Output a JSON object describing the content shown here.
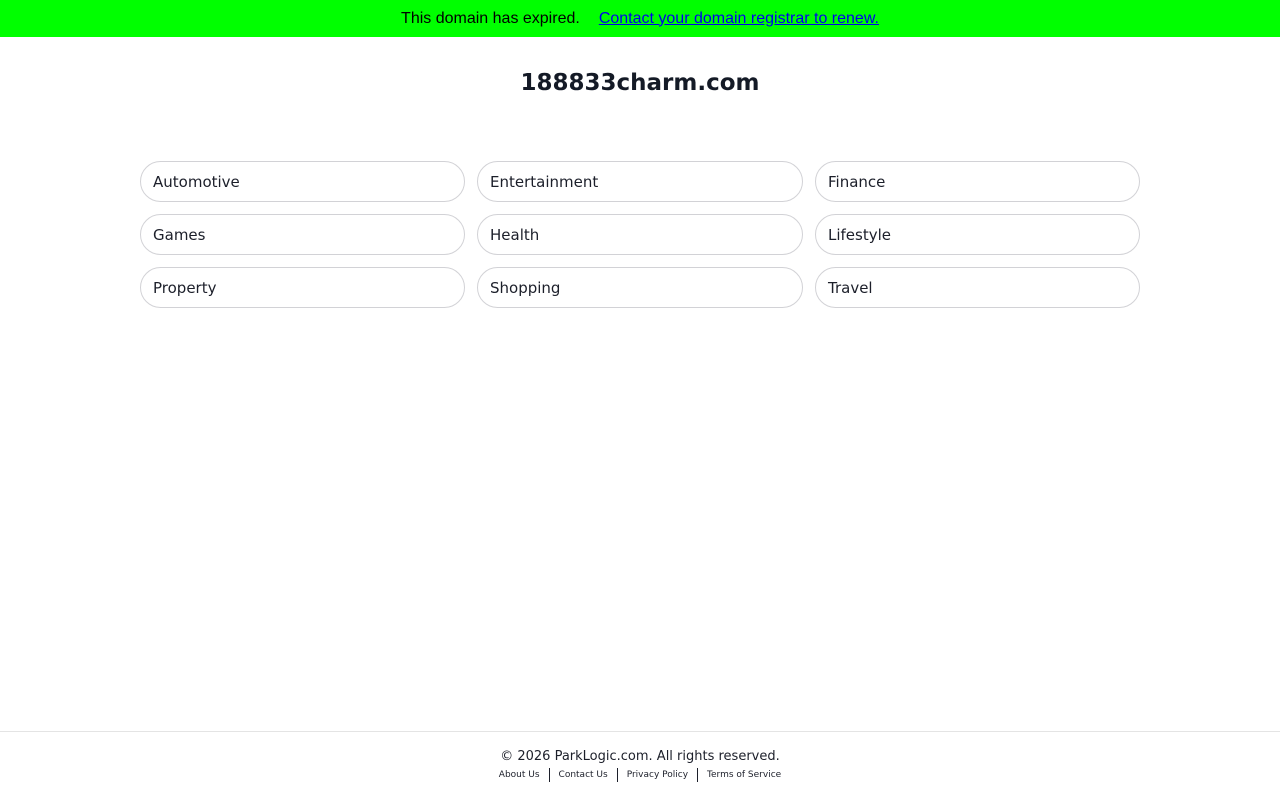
{
  "banner": {
    "message": "This domain has expired.",
    "link_text": "Contact your domain registrar to renew.",
    "background_color": "#00ff00",
    "link_color": "#0000ee"
  },
  "domain": {
    "title": "188833charm.com"
  },
  "categories": [
    {
      "label": "Automotive"
    },
    {
      "label": "Entertainment"
    },
    {
      "label": "Finance"
    },
    {
      "label": "Games"
    },
    {
      "label": "Health"
    },
    {
      "label": "Lifestyle"
    },
    {
      "label": "Property"
    },
    {
      "label": "Shopping"
    },
    {
      "label": "Travel"
    }
  ],
  "footer": {
    "copyright": "© 2026 ParkLogic.com. All rights reserved.",
    "links": [
      {
        "label": "About Us"
      },
      {
        "label": "Contact Us"
      },
      {
        "label": "Privacy Policy"
      },
      {
        "label": "Terms of Service"
      }
    ]
  }
}
